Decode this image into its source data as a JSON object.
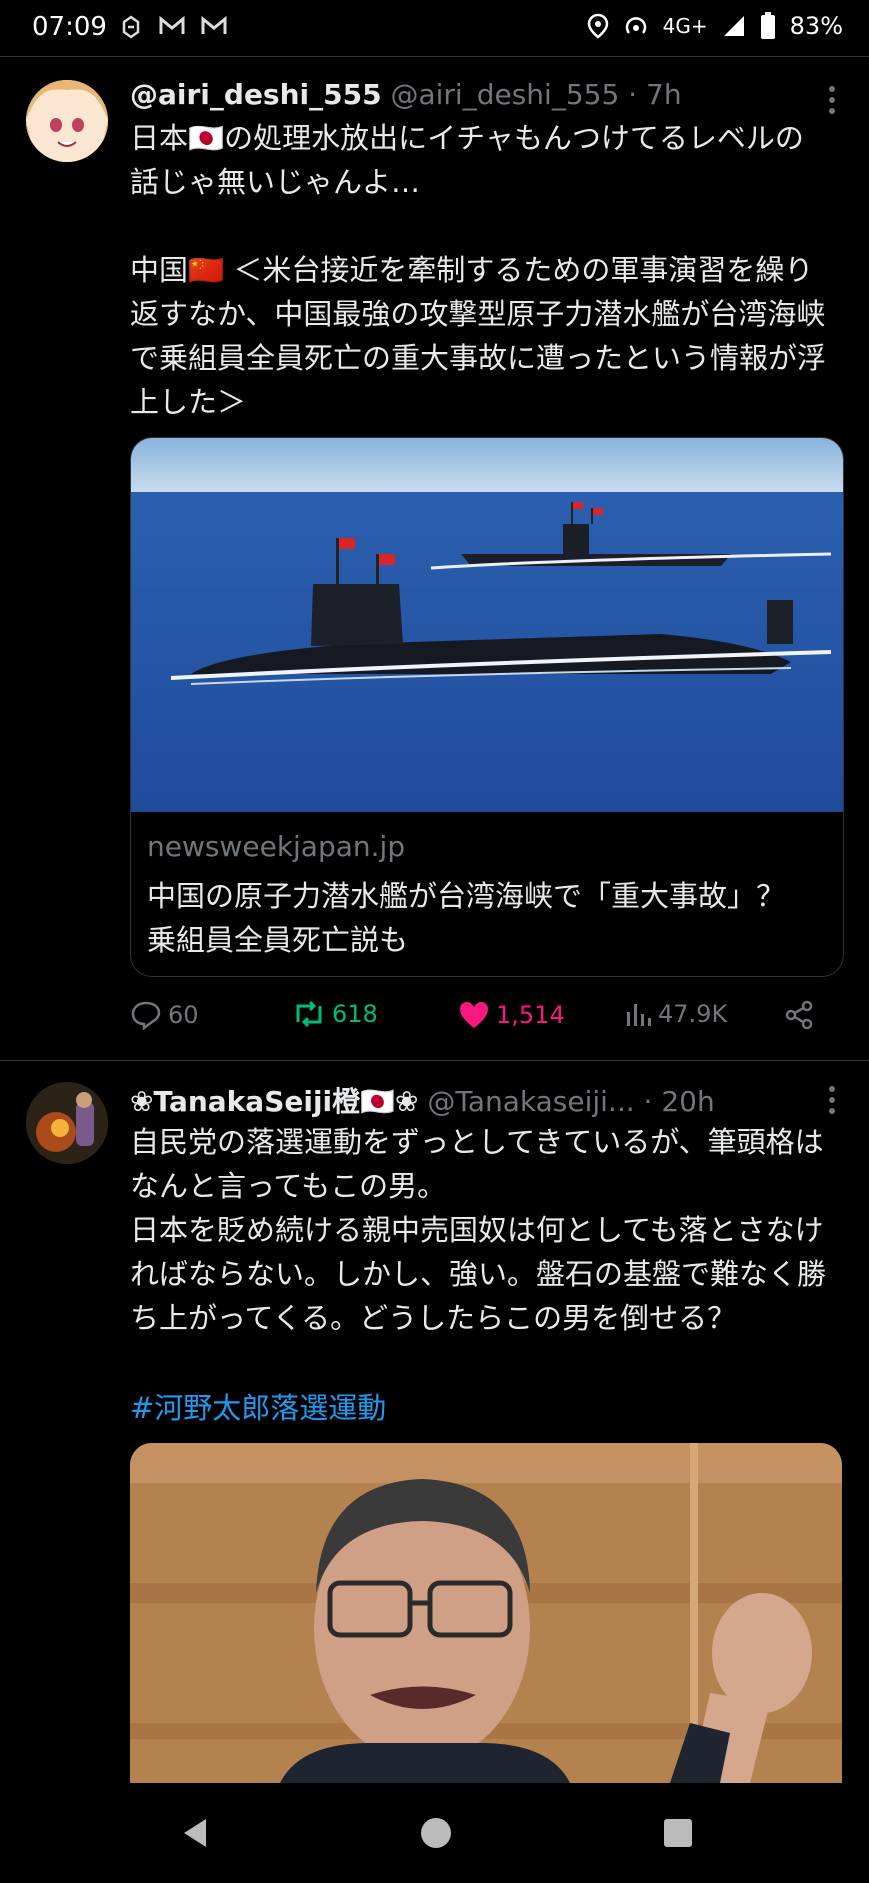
{
  "status_bar": {
    "time": "07:09",
    "network": "4G+",
    "battery": "83%"
  },
  "tweets": [
    {
      "display_name": "@airi_deshi_555",
      "handle": "@airi_deshi_555",
      "time": "7h",
      "text": "日本🇯🇵の処理水放出にイチャもんつけてるレベルの話じゃ無いじゃんよ…\n\n中国🇨🇳 ＜米台接近を牽制するための軍事演習を繰り返すなか、中国最強の攻撃型原子力潜水艦が台湾海峡で乗組員全員死亡の重大事故に遭ったという情報が浮上した＞",
      "card": {
        "domain": "newsweekjapan.jp",
        "title": "中国の原子力潜水艦が台湾海峡で「重大事故」？　乗組員全員死亡説も"
      },
      "stats": {
        "replies": "60",
        "retweets": "618",
        "likes": "1,514",
        "views": "47.9K"
      }
    },
    {
      "display_name": "❀TanakaSeiji橙🇯🇵❀",
      "handle": "@Tanakaseiji...",
      "time": "20h",
      "text": "自民党の落選運動をずっとしてきているが、筆頭格はなんと言ってもこの男。\n日本を貶め続ける親中売国奴は何としても落とさなければならない。しかし、強い。盤石の基盤で難なく勝ち上がってくる。どうしたらこの男を倒せる？",
      "hashtag": "#河野太郎落選運動"
    }
  ],
  "colors": {
    "background": "#000000",
    "text": "#e7e9ea",
    "muted": "#71767b",
    "link": "#1d9bf0",
    "retweet": "#00ba7c",
    "like": "#f91880"
  }
}
